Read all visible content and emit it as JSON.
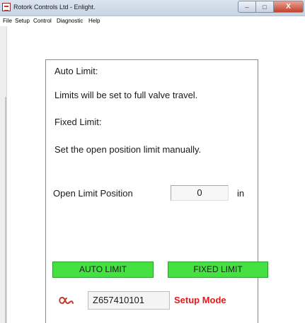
{
  "window": {
    "title": "Rotork Controls Ltd - Enlight.",
    "close_glyph": "X"
  },
  "menu": [
    "File",
    "Setup",
    "Control",
    "Diagnostic",
    "Help"
  ],
  "content": {
    "auto_limit_heading": "Auto Limit:",
    "auto_limit_desc": "Limits will be set to full valve travel.",
    "fixed_limit_heading": "Fixed Limit:",
    "fixed_limit_desc": "Set the open position limit manually.",
    "open_limit_label": "Open Limit Position",
    "open_limit_value": "0",
    "open_limit_unit": "in",
    "auto_limit_button": "AUTO LIMIT",
    "fixed_limit_button": "FIXED LIMIT"
  },
  "status": {
    "logo_icon": "rotork-logo-icon",
    "serial": "Z657410101",
    "mode": "Setup Mode",
    "mode_color": "#e01b1b"
  },
  "colors": {
    "button_green": "#45e041"
  }
}
